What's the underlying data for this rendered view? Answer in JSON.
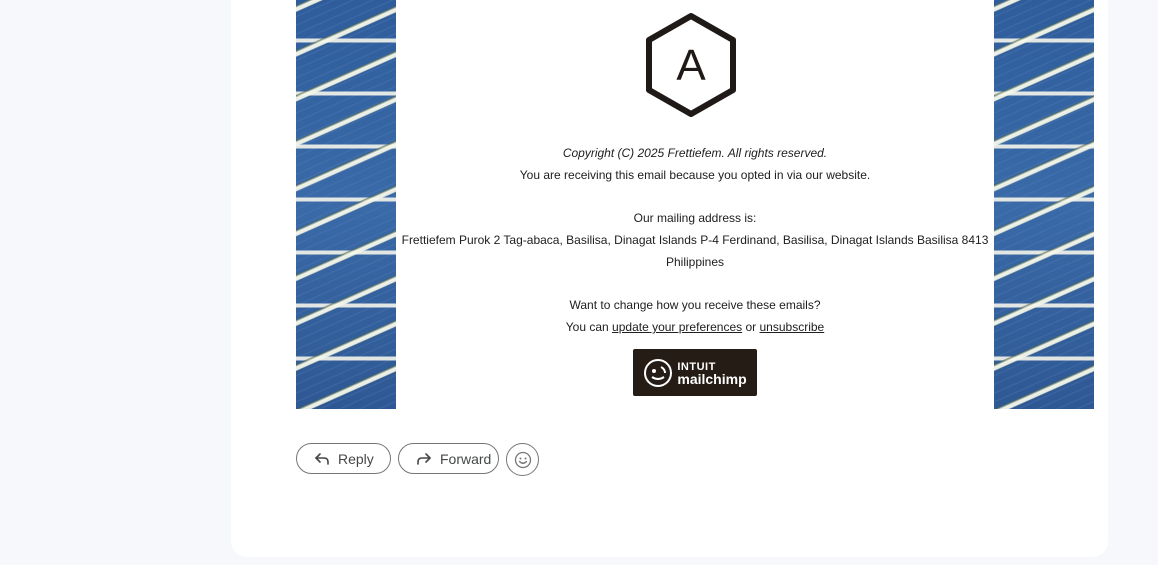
{
  "footer": {
    "copyright": "Copyright (C) 2025 Frettiefem. All rights reserved.",
    "optin_text": "You are receiving this email because you opted in via our website.",
    "mailing_heading": "Our mailing address is:",
    "address_line1": "Frettiefem Purok 2 Tag-abaca, Basilisa, Dinagat Islands P-4 Ferdinand, Basilisa, Dinagat Islands Basilisa 8413",
    "address_line2": "Philippines",
    "change_question": "Want to change how you receive these emails?",
    "you_can": "You can",
    "update_link": "update your preferences",
    "or": "or",
    "unsubscribe_link": "unsubscribe"
  },
  "logo": {
    "letter": "A",
    "icon": "hexagon-a-logo"
  },
  "badge": {
    "line1": "INTUIT",
    "line2": "mailchimp",
    "icon": "mailchimp-freddie-icon"
  },
  "actions": {
    "reply_label": "Reply",
    "forward_label": "Forward",
    "reply_icon": "reply-arrow-icon",
    "forward_icon": "forward-arrow-icon",
    "emoji_icon": "smiley-icon"
  },
  "colors": {
    "background": "#f6f8fc",
    "card": "#ffffff",
    "badge": "#241c15",
    "text": "#202020",
    "button_border": "#747775"
  }
}
